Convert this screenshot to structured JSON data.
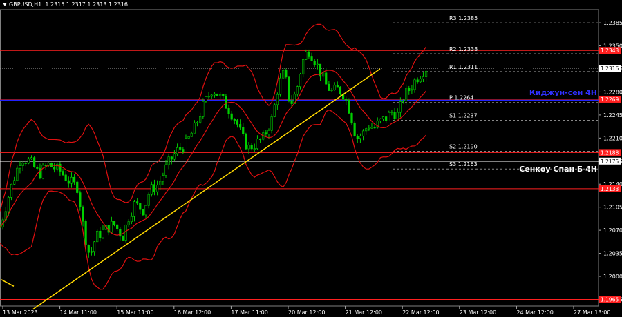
{
  "header": {
    "symbol": "GBPUSD,H1",
    "ohlc": "1.2315 1.2317 1.2313 1.2316"
  },
  "chart_data": {
    "type": "candlestick",
    "symbol": "GBPUSD",
    "timeframe": "H1",
    "ylim": [
      1.1955,
      1.2405
    ],
    "y_ticks": [
      "1.2385",
      "1.2350",
      "1.2316",
      "1.2280",
      "1.2245",
      "1.2210",
      "1.2175",
      "1.2140",
      "1.2105",
      "1.2070",
      "1.2035",
      "1.2000",
      "1.1965"
    ],
    "x_ticks": [
      "13 Mar 2023",
      "14 Mar 11:00",
      "15 Mar 11:00",
      "16 Mar 12:00",
      "17 Mar 11:00",
      "20 Mar 12:00",
      "21 Mar 12:00",
      "22 Mar 12:00",
      "23 Mar 12:00",
      "24 Mar 12:00",
      "27 Mar 13:00"
    ],
    "levels": [
      {
        "label": "1.2343",
        "value": 1.2343,
        "color": "#ff2020",
        "kind": "resistance"
      },
      {
        "label": "1.2269",
        "value": 1.2269,
        "color": "#ff2020",
        "kind": "support"
      },
      {
        "label": "1.2188",
        "value": 1.2188,
        "color": "#ff2020",
        "kind": "support"
      },
      {
        "label": "1.2175",
        "value": 1.2175,
        "color": "#ffffff",
        "kind": "senkou"
      },
      {
        "label": "1.2133",
        "value": 1.2133,
        "color": "#ff2020",
        "kind": "support"
      },
      {
        "label": "1.1965",
        "value": 1.1965,
        "color": "#ff2020",
        "kind": "support"
      }
    ],
    "kijun": {
      "value": 1.2267,
      "label": "Киджун-сен 4H",
      "color": "#2020ff"
    },
    "senkou_label": "Сенкоу Спан Б 4H",
    "current_price": {
      "value": 1.2316,
      "label": "1.2316"
    },
    "pivots": [
      {
        "label": "R3",
        "value": 1.2385,
        "text": "1.2385"
      },
      {
        "label": "R2",
        "value": 1.2338,
        "text": "1.2338"
      },
      {
        "label": "R1",
        "value": 1.2311,
        "text": "1.2311"
      },
      {
        "label": "P",
        "value": 1.2264,
        "text": "1.2264"
      },
      {
        "label": "S1",
        "value": 1.2237,
        "text": "1.2237"
      },
      {
        "label": "S2",
        "value": 1.219,
        "text": "1.2190"
      },
      {
        "label": "S3",
        "value": 1.2163,
        "text": "1.2163"
      }
    ],
    "trendline": {
      "from": {
        "t": 0.055,
        "v": 1.195
      },
      "to": {
        "t": 0.635,
        "v": 1.2315
      },
      "color": "#ffd700"
    },
    "close_path": [
      [
        0.0,
        1.2075
      ],
      [
        0.02,
        1.214
      ],
      [
        0.035,
        1.218
      ],
      [
        0.05,
        1.2175
      ],
      [
        0.065,
        1.2155
      ],
      [
        0.08,
        1.217
      ],
      [
        0.1,
        1.216
      ],
      [
        0.115,
        1.2145
      ],
      [
        0.13,
        1.2135
      ],
      [
        0.14,
        1.207
      ],
      [
        0.15,
        1.203
      ],
      [
        0.16,
        1.206
      ],
      [
        0.175,
        1.207
      ],
      [
        0.19,
        1.208
      ],
      [
        0.205,
        1.206
      ],
      [
        0.215,
        1.209
      ],
      [
        0.225,
        1.211
      ],
      [
        0.24,
        1.21
      ],
      [
        0.25,
        1.213
      ],
      [
        0.265,
        1.214
      ],
      [
        0.28,
        1.217
      ],
      [
        0.295,
        1.219
      ],
      [
        0.31,
        1.22
      ],
      [
        0.325,
        1.2225
      ],
      [
        0.34,
        1.226
      ],
      [
        0.355,
        1.2285
      ],
      [
        0.37,
        1.227
      ],
      [
        0.385,
        1.225
      ],
      [
        0.395,
        1.2235
      ],
      [
        0.405,
        1.221
      ],
      [
        0.415,
        1.2195
      ],
      [
        0.425,
        1.22
      ],
      [
        0.44,
        1.221
      ],
      [
        0.455,
        1.224
      ],
      [
        0.465,
        1.229
      ],
      [
        0.475,
        1.231
      ],
      [
        0.485,
        1.226
      ],
      [
        0.495,
        1.228
      ],
      [
        0.505,
        1.2325
      ],
      [
        0.515,
        1.2345
      ],
      [
        0.525,
        1.233
      ],
      [
        0.535,
        1.231
      ],
      [
        0.545,
        1.229
      ],
      [
        0.555,
        1.228
      ],
      [
        0.565,
        1.2285
      ],
      [
        0.575,
        1.2275
      ],
      [
        0.585,
        1.225
      ],
      [
        0.595,
        1.221
      ],
      [
        0.605,
        1.2215
      ],
      [
        0.615,
        1.223
      ],
      [
        0.625,
        1.2225
      ],
      [
        0.635,
        1.2235
      ],
      [
        0.645,
        1.224
      ],
      [
        0.655,
        1.225
      ],
      [
        0.665,
        1.2245
      ],
      [
        0.675,
        1.2275
      ],
      [
        0.685,
        1.2285
      ],
      [
        0.695,
        1.23
      ],
      [
        0.705,
        1.231
      ],
      [
        0.712,
        1.2316
      ]
    ],
    "series": [
      {
        "name": "price",
        "color": "#00d000"
      },
      {
        "name": "bollinger",
        "color": "#e01010"
      }
    ]
  }
}
